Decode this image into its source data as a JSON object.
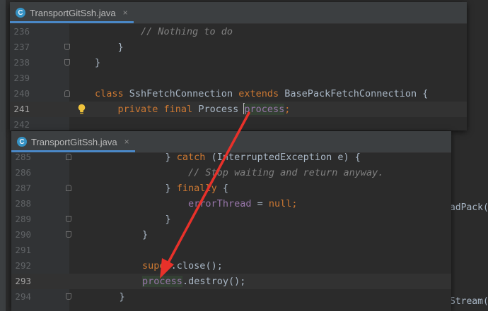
{
  "background": {
    "fragments": [
      "adPack(",
      "Stream("
    ],
    "colors": {
      "editor": "#2b2b2b",
      "keyword": "#cc7832",
      "comment": "#808080",
      "field": "#9876aa",
      "text": "#a9b7c6",
      "annotation_arrow": "#e8312a"
    }
  },
  "panel_top": {
    "tab": {
      "icon": "class-icon",
      "icon_letter": "C",
      "label": "TransportGitSsh.java",
      "close": "×"
    },
    "lines": [
      {
        "num": "236",
        "t": [
          "        // Nothing to do"
        ]
      },
      {
        "num": "237",
        "t": [
          "    }"
        ]
      },
      {
        "num": "238",
        "t": [
          "}"
        ]
      },
      {
        "num": "239",
        "t": [
          ""
        ]
      },
      {
        "num": "240",
        "t": [
          "class",
          " SshFetchConnection ",
          "extends",
          " BasePackFetchConnection {"
        ]
      },
      {
        "num": "241",
        "t": [
          "    ",
          "private final",
          " Process ",
          "process",
          ";"
        ]
      },
      {
        "num": "242",
        "t": [
          ""
        ]
      }
    ]
  },
  "panel_bottom": {
    "tab": {
      "icon": "class-icon",
      "icon_letter": "C",
      "label": "TransportGitSsh.java",
      "close": "×"
    },
    "lines": [
      {
        "num": "285",
        "t": [
          "            } ",
          "catch",
          " (InterruptedException e) {"
        ]
      },
      {
        "num": "286",
        "t": [
          "                // Stop waiting and return anyway."
        ]
      },
      {
        "num": "287",
        "t": [
          "            } ",
          "finally",
          " {"
        ]
      },
      {
        "num": "288",
        "t": [
          "                ",
          "errorThread",
          " = ",
          "null",
          ";"
        ]
      },
      {
        "num": "289",
        "t": [
          "            }"
        ]
      },
      {
        "num": "290",
        "t": [
          "        }"
        ]
      },
      {
        "num": "291",
        "t": [
          ""
        ]
      },
      {
        "num": "292",
        "t": [
          "        ",
          "super",
          ".close();"
        ]
      },
      {
        "num": "293",
        "t": [
          "        ",
          "process",
          ".destroy();"
        ]
      },
      {
        "num": "294",
        "t": [
          "    }"
        ]
      }
    ]
  }
}
